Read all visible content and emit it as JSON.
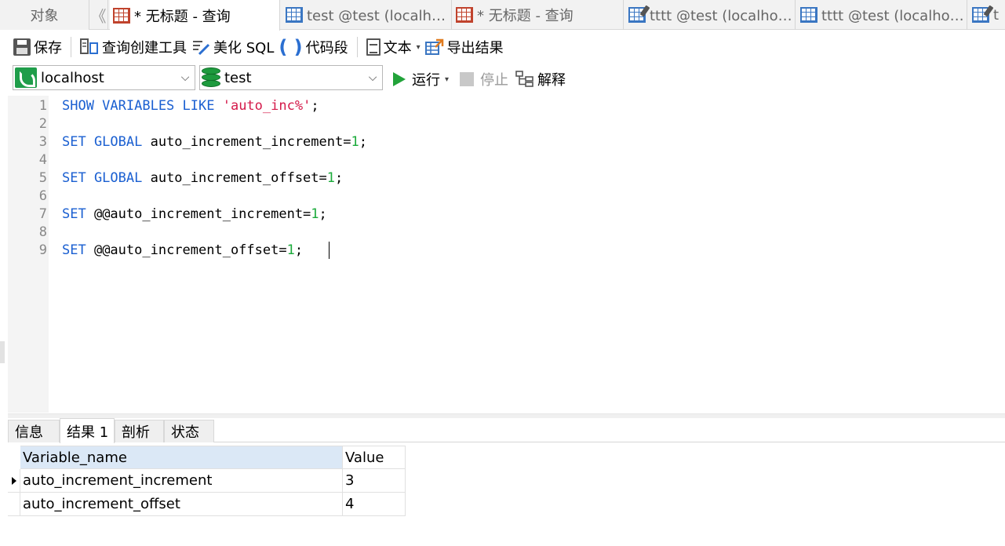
{
  "tabs": {
    "objects": "对象",
    "scroll_glyph": "《",
    "items": [
      {
        "title": "* 无标题 - 查询",
        "icon": "query-table-icon",
        "active": true
      },
      {
        "title": "test @test (localhost) - 表",
        "icon": "table-grid-icon",
        "active": false
      },
      {
        "title": "* 无标题 - 查询",
        "icon": "query-table-icon",
        "active": false
      },
      {
        "title": "tttt @test (localhost) - 表",
        "icon": "table-design-icon",
        "active": false
      },
      {
        "title": "tttt @test (localhost) - 表",
        "icon": "table-grid-icon",
        "active": false
      },
      {
        "title": "t",
        "icon": "table-design-icon",
        "active": false
      }
    ]
  },
  "toolbar": {
    "save": "保存",
    "query_builder": "查询创建工具",
    "beautify": "美化 SQL",
    "snippet": "代码段",
    "text": "文本",
    "export": "导出结果"
  },
  "connection": {
    "host": "localhost",
    "database": "test"
  },
  "actions": {
    "run": "运行",
    "stop": "停止",
    "explain": "解释"
  },
  "editor": {
    "line_numbers": [
      "1",
      "2",
      "3",
      "4",
      "5",
      "6",
      "7",
      "8",
      "9"
    ]
  },
  "result_tabs": {
    "info": "信息",
    "result1": "结果 1",
    "profile": "剖析",
    "status": "状态"
  },
  "result": {
    "columns": [
      "Variable_name",
      "Value"
    ],
    "rows": [
      {
        "name": "auto_increment_increment",
        "value": "3"
      },
      {
        "name": "auto_increment_offset",
        "value": "4"
      }
    ]
  },
  "colors": {
    "keyword": "#1a5fd1",
    "string": "#d41a4a",
    "number": "#1aaa3a",
    "run_green": "#22a33a",
    "header_highlight": "#dbe8f6"
  }
}
